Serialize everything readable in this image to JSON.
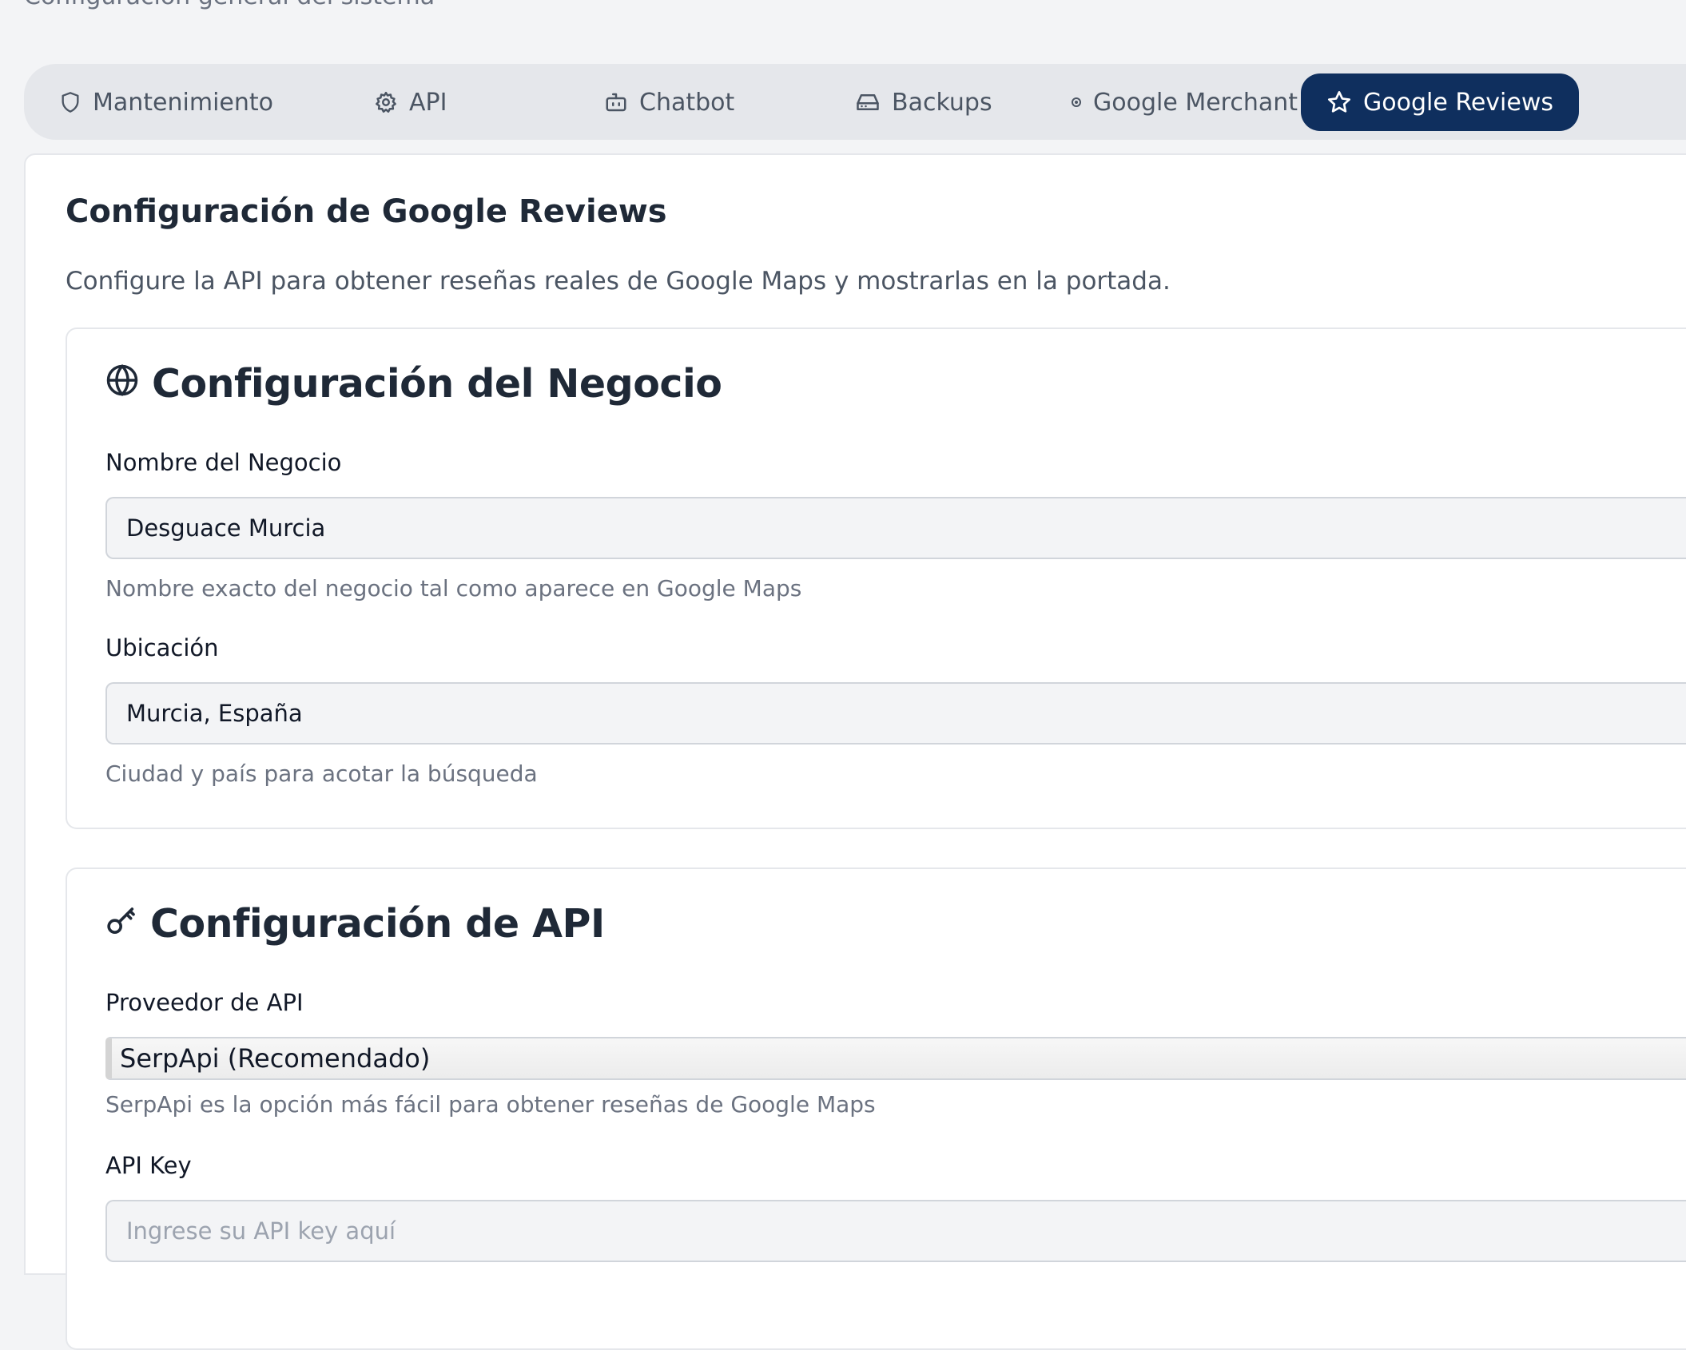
{
  "page": {
    "subtitle": "Configuración general del sistema"
  },
  "tabs": [
    {
      "label": "Mantenimiento",
      "icon": "shield-icon",
      "active": false
    },
    {
      "label": "API",
      "icon": "gear-icon",
      "active": false
    },
    {
      "label": "Chatbot",
      "icon": "bot-icon",
      "active": false
    },
    {
      "label": "Backups",
      "icon": "hard-drive-icon",
      "active": false
    },
    {
      "label": "Google Merchant",
      "icon": "dot-icon",
      "active": false
    },
    {
      "label": "Google Reviews",
      "icon": "star-icon",
      "active": true
    }
  ],
  "main": {
    "title": "Configuración de Google Reviews",
    "description": "Configure la API para obtener reseñas reales de Google Maps y mostrarlas en la portada."
  },
  "business_section": {
    "title": "Configuración del Negocio",
    "icon": "globe-icon",
    "name_label": "Nombre del Negocio",
    "name_value": "Desguace Murcia",
    "name_help": "Nombre exacto del negocio tal como aparece en Google Maps",
    "location_label": "Ubicación",
    "location_value": "Murcia, España",
    "location_help": "Ciudad y país para acotar la búsqueda"
  },
  "api_section": {
    "title": "Configuración de API",
    "icon": "key-icon",
    "provider_label": "Proveedor de API",
    "provider_value": "SerpApi (Recomendado)",
    "provider_help": "SerpApi es la opción más fácil para obtener reseñas de Google Maps",
    "key_label": "API Key",
    "key_placeholder": "Ingrese su API key aquí"
  },
  "colors": {
    "active_tab_bg": "#0f2f5e",
    "page_bg": "#f3f4f6",
    "tabs_bar_bg": "#e5e7eb"
  }
}
